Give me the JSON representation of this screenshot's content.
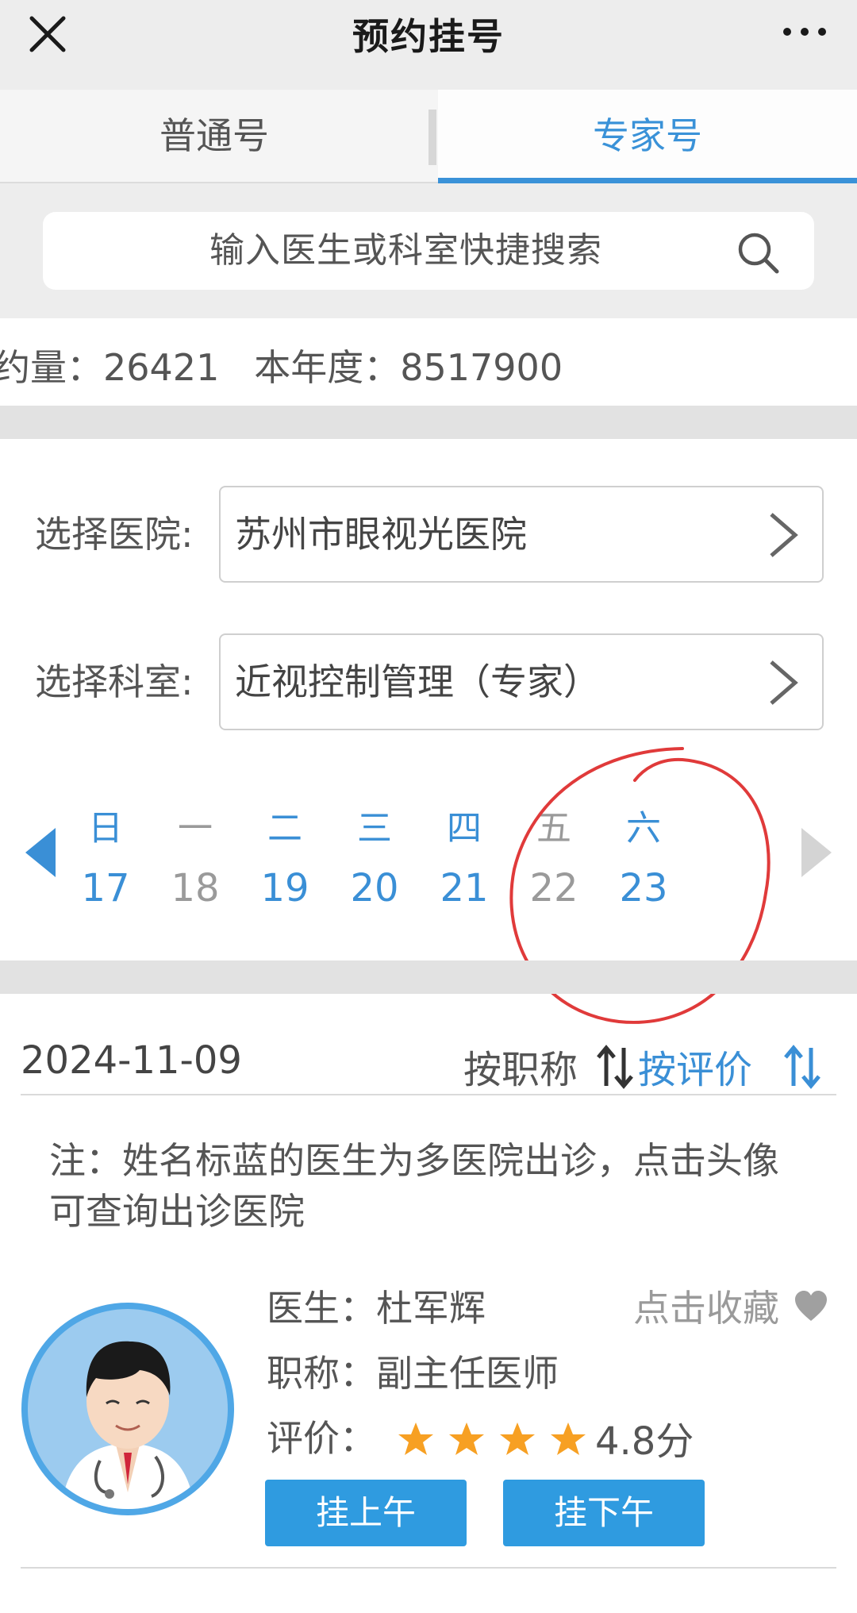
{
  "header": {
    "title": "预约挂号"
  },
  "tabs": [
    {
      "label": "普通号",
      "active": false
    },
    {
      "label": "专家号",
      "active": true
    }
  ],
  "search": {
    "placeholder": "输入医生或科室快捷搜索"
  },
  "stats": {
    "label1": "约量：",
    "value1": "26421",
    "label2": "本年度：",
    "value2": "8517900"
  },
  "hospital": {
    "label": "选择医院:",
    "value": "苏州市眼视光医院"
  },
  "department": {
    "label": "选择科室:",
    "value": "近视控制管理（专家）"
  },
  "calendar": {
    "days": [
      {
        "weekday": "日",
        "date": "17",
        "available": true
      },
      {
        "weekday": "一",
        "date": "18",
        "available": false
      },
      {
        "weekday": "二",
        "date": "19",
        "available": true
      },
      {
        "weekday": "三",
        "date": "20",
        "available": true
      },
      {
        "weekday": "四",
        "date": "21",
        "available": true
      },
      {
        "weekday": "五",
        "date": "22",
        "available": false
      },
      {
        "weekday": "六",
        "date": "23",
        "available": true
      }
    ]
  },
  "list": {
    "date": "2024-11-09",
    "sort_by_title": "按职称",
    "sort_by_rating": "按评价",
    "note": "注：姓名标蓝的医生为多医院出诊，点击头像可查询出诊医院"
  },
  "doctor": {
    "name_label": "医生：",
    "name": "杜军辉",
    "title_label": "职称：",
    "title": "副主任医师",
    "rating_label": "评价：",
    "rating_stars": 4,
    "rating_score": "4.8分",
    "favorite_label": "点击收藏",
    "am_button": "挂上午",
    "pm_button": "挂下午"
  },
  "colors": {
    "accent": "#3a92d8",
    "button": "#2f9be0",
    "annotation": "#e03a3a",
    "star": "#f7a023"
  }
}
